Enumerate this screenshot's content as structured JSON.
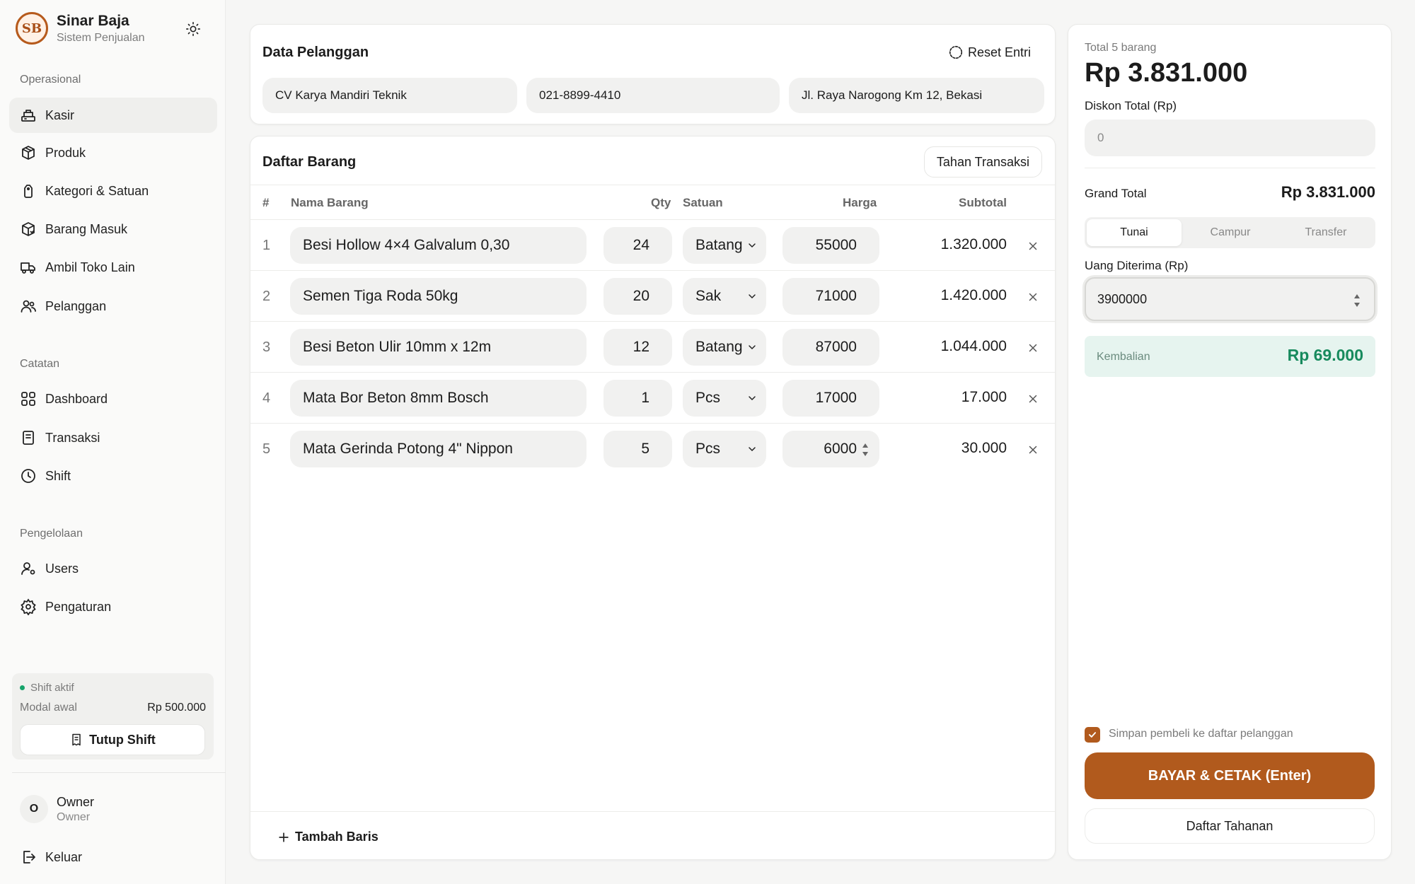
{
  "brand": {
    "logo_text": "SB",
    "name": "Sinar Baja",
    "subtitle": "Sistem Penjualan"
  },
  "sidebar": {
    "section_operasional": "Operasional",
    "section_catatan": "Catatan",
    "section_pengelolaan": "Pengelolaan",
    "items": [
      {
        "label": "Kasir",
        "icon": "cashier-icon",
        "active": true
      },
      {
        "label": "Produk",
        "icon": "box-icon"
      },
      {
        "label": "Kategori & Satuan",
        "icon": "tag-icon"
      },
      {
        "label": "Barang Masuk",
        "icon": "package-in-icon"
      },
      {
        "label": "Ambil Toko Lain",
        "icon": "truck-icon"
      },
      {
        "label": "Pelanggan",
        "icon": "users-icon"
      },
      {
        "label": "Dashboard",
        "icon": "grid-icon"
      },
      {
        "label": "Transaksi",
        "icon": "receipt-icon"
      },
      {
        "label": "Shift",
        "icon": "clock-icon"
      },
      {
        "label": "Users",
        "icon": "user-cog-icon"
      },
      {
        "label": "Pengaturan",
        "icon": "gear-icon"
      }
    ],
    "logout_label": "Keluar"
  },
  "shift": {
    "status": "Shift aktif",
    "modal_label": "Modal awal",
    "modal_value": "Rp 500.000",
    "close_label": "Tutup Shift"
  },
  "user": {
    "initial": "O",
    "name": "Owner",
    "role": "Owner"
  },
  "customer": {
    "title": "Data Pelanggan",
    "reset_label": "Reset Entri",
    "name": "CV Karya Mandiri Teknik",
    "phone": "021-8899-4410",
    "address": "Jl. Raya Narogong Km 12, Bekasi"
  },
  "items_panel": {
    "title": "Daftar Barang",
    "hold_label": "Tahan Transaksi",
    "headers": {
      "num": "#",
      "name": "Nama Barang",
      "qty": "Qty",
      "unit": "Satuan",
      "price": "Harga",
      "subtotal": "Subtotal"
    },
    "rows": [
      {
        "num": "1",
        "name": "Besi Hollow 4×4 Galvalum 0,30",
        "qty": "24",
        "unit": "Batang",
        "price": "55000",
        "subtotal": "1.320.000"
      },
      {
        "num": "2",
        "name": "Semen Tiga Roda 50kg",
        "qty": "20",
        "unit": "Sak",
        "price": "71000",
        "subtotal": "1.420.000"
      },
      {
        "num": "3",
        "name": "Besi Beton Ulir 10mm x 12m",
        "qty": "12",
        "unit": "Batang",
        "price": "87000",
        "subtotal": "1.044.000"
      },
      {
        "num": "4",
        "name": "Mata Bor Beton 8mm Bosch",
        "qty": "1",
        "unit": "Pcs",
        "price": "17000",
        "subtotal": "17.000"
      },
      {
        "num": "5",
        "name": "Mata Gerinda Potong 4\" Nippon",
        "qty": "5",
        "unit": "Pcs",
        "price": "6000",
        "subtotal": "30.000"
      }
    ],
    "add_row_label": "Tambah Baris"
  },
  "summary": {
    "total_label": "Total 5 barang",
    "total_value": "Rp 3.831.000",
    "discount_label": "Diskon Total (Rp)",
    "discount_placeholder": "0",
    "grand_label": "Grand Total",
    "grand_value": "Rp 3.831.000",
    "tabs": [
      "Tunai",
      "Campur",
      "Transfer"
    ],
    "cash_label": "Uang Diterima (Rp)",
    "cash_value": "3900000",
    "change_label": "Kembalian",
    "change_value": "Rp 69.000",
    "save_customer_label": "Simpan pembeli ke daftar pelanggan",
    "pay_label": "BAYAR & CETAK (Enter)",
    "held_label": "Daftar Tahanan"
  },
  "colors": {
    "accent": "#b15a1d",
    "success": "#16a36a",
    "change_text": "#178a5d"
  }
}
